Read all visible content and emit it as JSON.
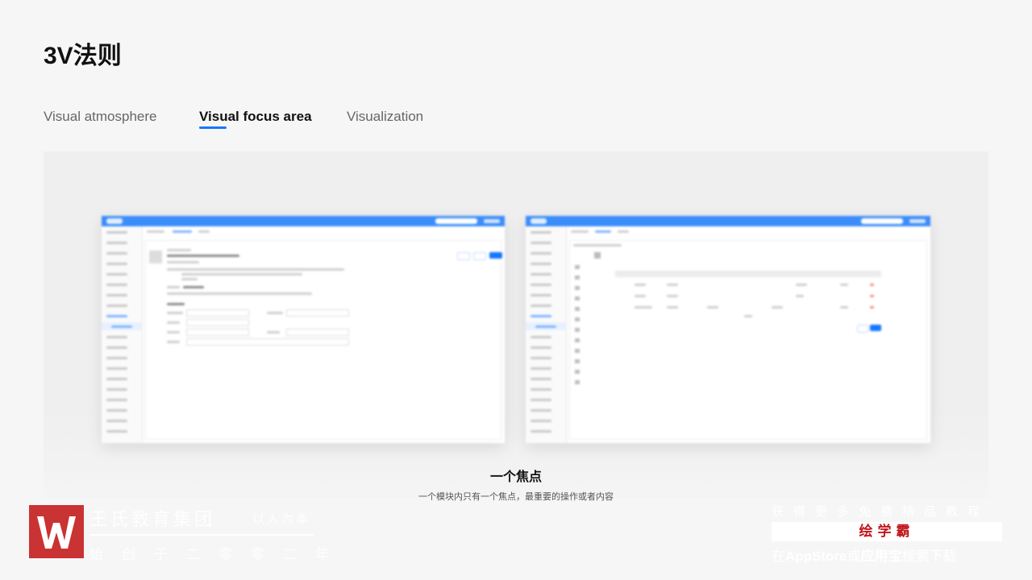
{
  "page": {
    "title": "3V法则"
  },
  "tabs": [
    {
      "label": "Visual atmosphere",
      "active": false
    },
    {
      "label": "Visual focus area",
      "active": true
    },
    {
      "label": "Visualization",
      "active": false
    }
  ],
  "caption": {
    "title": "一个焦点",
    "subtitle": "一个模块内只有一个焦点，最重要的操作或者内容"
  },
  "brand": {
    "logo_letter": "W",
    "name": "王氏教育集团",
    "slogan": "以人为本",
    "founded": "始创于二零零二年"
  },
  "promo": {
    "top": "获得更多免费精品教程",
    "name": "绘学霸",
    "bottom_prefix": "在",
    "bottom_store": "AppStore",
    "bottom_mid": "或",
    "bottom_app": "应用宝",
    "bottom_suffix": "搜索下载"
  },
  "colors": {
    "accent": "#1677ff",
    "brand_red": "#c51f1f",
    "promo_red": "#c0161c"
  }
}
